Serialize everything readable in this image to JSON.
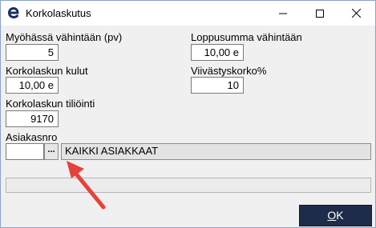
{
  "window": {
    "title": "Korkolaskutus",
    "icon": "e-logo-icon",
    "controls": [
      "minimize-icon",
      "maximize-icon",
      "close-icon"
    ]
  },
  "form": {
    "min_days_label": "Myöhässä vähintään (pv)",
    "min_days_value": "5",
    "min_total_label": "Loppusumma vähintään",
    "min_total_value": "10,00 e",
    "invoice_costs_label": "Korkolaskun kulut",
    "invoice_costs_value": "10,00 e",
    "penalty_rate_label": "Viivästyskorko%",
    "penalty_rate_value": "10",
    "account_label": "Korkolaskun tiliöinti",
    "account_value": "9170",
    "customer_label": "Asiakasnro",
    "customer_value": "",
    "browse_label": "...",
    "customer_name": "KAIKKI ASIAKKAAT"
  },
  "status_text": "",
  "ok_label_underlined": "O",
  "ok_label_rest": "K",
  "colors": {
    "ok_button_bg": "#1e2b4a",
    "arrow": "#e8413a",
    "logo": "#1c2f63"
  }
}
